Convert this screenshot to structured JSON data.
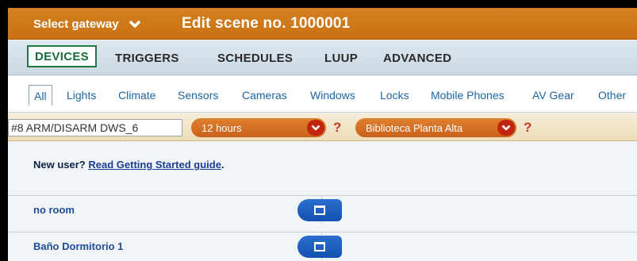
{
  "header": {
    "gateway_label": "Select gateway",
    "scene_title": "Edit scene no. 1000001",
    "accent_color": "#c97114"
  },
  "main_tabs": [
    {
      "label": "DEVICES",
      "active": true
    },
    {
      "label": "TRIGGERS",
      "active": false
    },
    {
      "label": "SCHEDULES",
      "active": false
    },
    {
      "label": "LUUP",
      "active": false
    },
    {
      "label": "ADVANCED",
      "active": false
    }
  ],
  "category_tabs": [
    {
      "label": "All",
      "active": true
    },
    {
      "label": "Lights"
    },
    {
      "label": "Climate"
    },
    {
      "label": "Sensors"
    },
    {
      "label": "Cameras"
    },
    {
      "label": "Windows"
    },
    {
      "label": "Locks"
    },
    {
      "label": "Mobile Phones"
    },
    {
      "label": "AV Gear"
    },
    {
      "label": "Other"
    }
  ],
  "filters": {
    "device_input_value": "#8 ARM/DISARM DWS_6",
    "time_select_value": "12 hours",
    "room_select_value": "Biblioteca Planta Alta",
    "help_mark": "?"
  },
  "notice": {
    "prefix": "New user?",
    "link": "Read Getting Started guide",
    "suffix": "."
  },
  "rooms": [
    {
      "name": "no room"
    },
    {
      "name": "Baño Dormitorio 1"
    }
  ]
}
